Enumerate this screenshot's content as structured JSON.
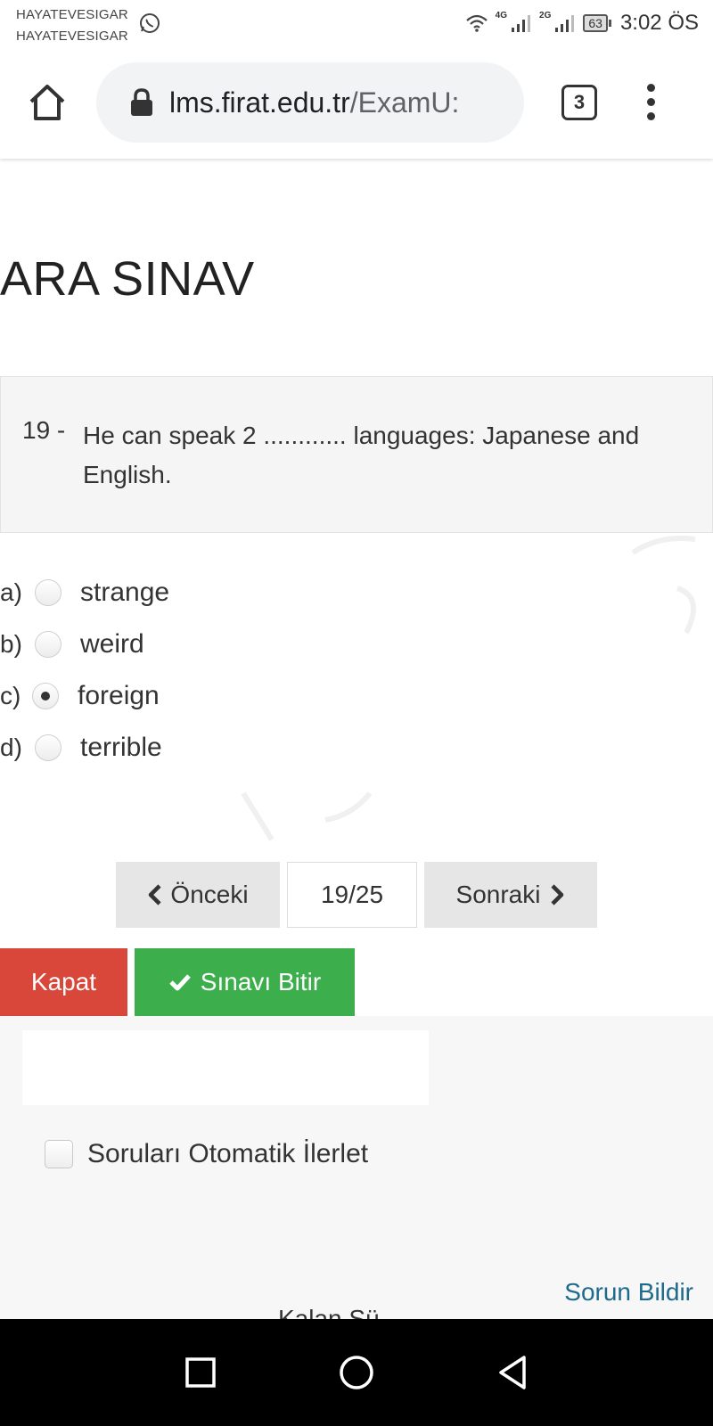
{
  "status_bar": {
    "notifications": [
      "HAYATEVESIGAR",
      "HAYATEVESIGAR"
    ],
    "network_1": "4G",
    "network_2": "2G",
    "battery": "63",
    "time": "3:02 ÖS"
  },
  "browser": {
    "url_host": "lms.firat.edu.tr",
    "url_path": "/ExamU:",
    "tab_count": "3"
  },
  "page": {
    "title": "ARA SINAV",
    "question": {
      "number": "19 -",
      "text": "He can speak 2 ............ languages: Japanese and English."
    },
    "options": [
      {
        "letter": "a)",
        "label": "strange",
        "selected": false
      },
      {
        "letter": "b)",
        "label": "weird",
        "selected": false
      },
      {
        "letter": "c)",
        "label": "foreign",
        "selected": true
      },
      {
        "letter": "d)",
        "label": "terrible",
        "selected": false
      }
    ],
    "pager": {
      "prev_label": "Önceki",
      "indicator": "19/25",
      "next_label": "Sonraki"
    },
    "close_label": "Kapat",
    "finish_label": "Sınavı Bitir",
    "auto_advance_label": "Soruları Otomatik İlerlet",
    "report_label": "Sorun Bildir",
    "cutoff_text": "Kalan Sü"
  },
  "colors": {
    "close_button": "#d9473a",
    "finish_button": "#3cae4c",
    "link": "#1e6a8d"
  }
}
